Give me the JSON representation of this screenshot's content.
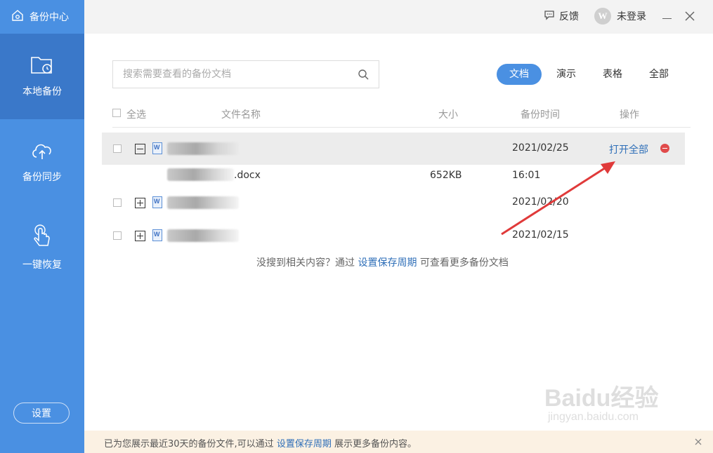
{
  "app": {
    "title": "备份中心"
  },
  "sidebar": {
    "items": [
      {
        "label": "本地备份",
        "icon": "folder-clock-icon",
        "active": true
      },
      {
        "label": "备份同步",
        "icon": "cloud-upload-icon",
        "active": false
      },
      {
        "label": "一键恢复",
        "icon": "hand-pointer-icon",
        "active": false
      }
    ],
    "settings_label": "设置"
  },
  "topbar": {
    "feedback_label": "反馈",
    "user_label": "未登录",
    "avatar_letter": "W"
  },
  "search": {
    "placeholder": "搜索需要查看的备份文档"
  },
  "tabs": [
    {
      "label": "文档",
      "active": true
    },
    {
      "label": "演示",
      "active": false
    },
    {
      "label": "表格",
      "active": false
    },
    {
      "label": "全部",
      "active": false
    }
  ],
  "table": {
    "headers": {
      "select_all": "全选",
      "name": "文件名称",
      "size": "大小",
      "time": "备份时间",
      "action": "操作"
    },
    "groups": [
      {
        "date": "2021/02/25",
        "expanded": true,
        "action": "打开全部"
      },
      {
        "date": "2021/02/20",
        "expanded": false
      },
      {
        "date": "2021/02/15",
        "expanded": false
      }
    ],
    "file": {
      "name_suffix": ".docx",
      "size": "652KB",
      "time": "16:01"
    }
  },
  "hint": {
    "prefix": "没搜到相关内容？通过 ",
    "link": "设置保存周期",
    "suffix": " 可查看更多备份文档"
  },
  "footer": {
    "prefix": "已为您展示最近30天的备份文件,可以通过 ",
    "link": "设置保存周期",
    "suffix": " 展示更多备份内容。"
  },
  "watermark": {
    "main": "Baidu经验",
    "sub": "jingyan.baidu.com"
  },
  "colors": {
    "sidebar": "#4a90e2",
    "sidebar_active": "#3a78c9",
    "link": "#2f6fb8",
    "annotation_arrow": "#e03a3a"
  }
}
